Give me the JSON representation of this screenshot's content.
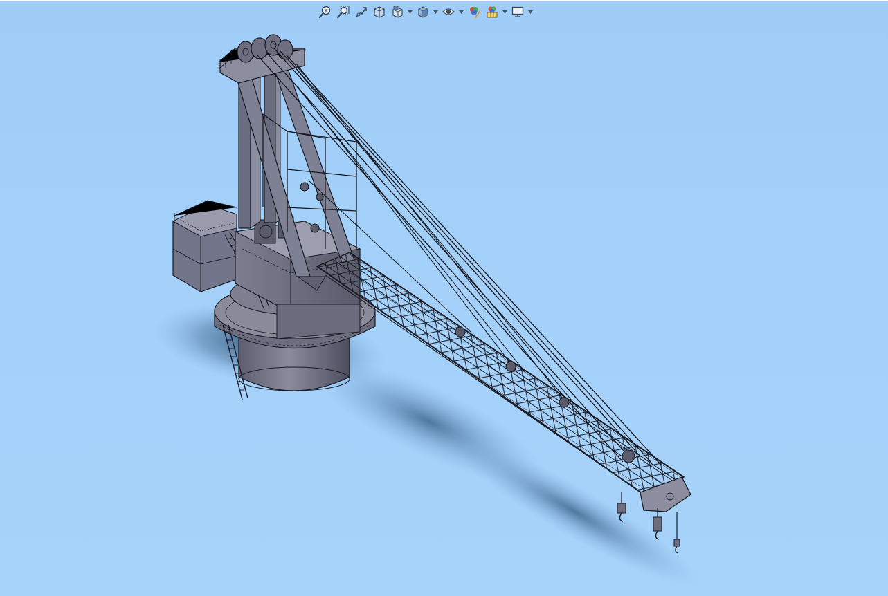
{
  "viewport": {
    "background_top": "#9fcdf8",
    "background_bottom": "#a7d3fa",
    "model_color": "#6c6e80",
    "model_edge_color": "#1a1a22"
  },
  "toolbar": {
    "buttons": [
      {
        "name": "zoom-to-fit",
        "icon": "zoom-to-fit-icon",
        "has_dropdown": false
      },
      {
        "name": "zoom-to-area",
        "icon": "zoom-to-area-icon",
        "has_dropdown": false
      },
      {
        "name": "previous-view",
        "icon": "previous-view-icon",
        "has_dropdown": false
      },
      {
        "name": "section-view",
        "icon": "section-view-icon",
        "has_dropdown": false
      },
      {
        "name": "view-orientation",
        "icon": "view-orientation-icon",
        "has_dropdown": true
      },
      {
        "name": "display-style",
        "icon": "display-style-icon",
        "has_dropdown": true
      },
      {
        "name": "hide-show-items",
        "icon": "hide-show-eye-icon",
        "has_dropdown": true
      },
      {
        "name": "edit-appearance",
        "icon": "edit-appearance-icon",
        "has_dropdown": false
      },
      {
        "name": "apply-scene",
        "icon": "apply-scene-icon",
        "has_dropdown": true
      },
      {
        "name": "view-settings",
        "icon": "view-settings-monitor-icon",
        "has_dropdown": true
      }
    ]
  }
}
